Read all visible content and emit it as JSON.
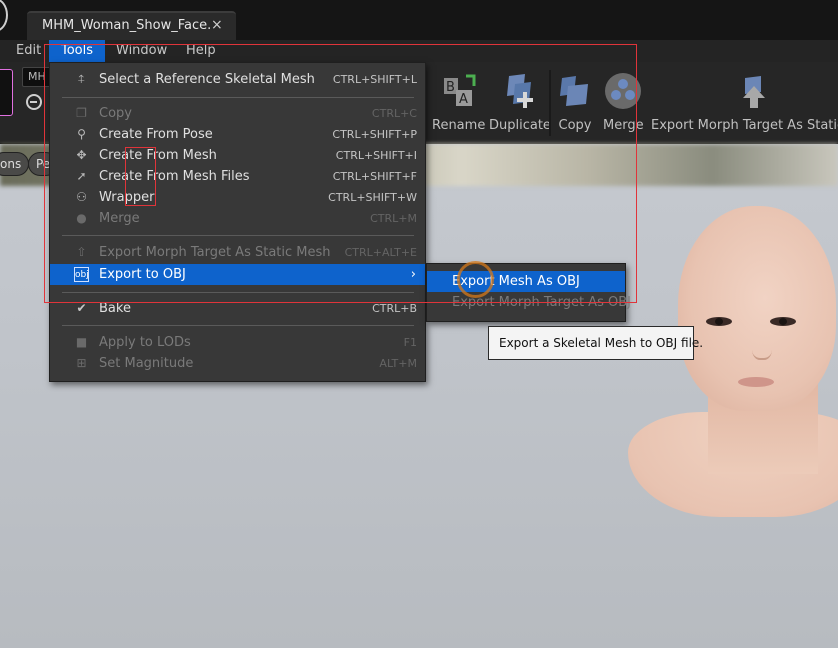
{
  "tab": {
    "title": "MHM_Woman_Show_Face...",
    "close": "×"
  },
  "menubar": {
    "items": [
      {
        "label": "Edit"
      },
      {
        "label": "Tools"
      },
      {
        "label": "Window"
      },
      {
        "label": "Help"
      }
    ]
  },
  "toolbar": {
    "asset_name": "MH",
    "buttons": [
      {
        "label": "Rename",
        "icon": "rename-icon"
      },
      {
        "label": "Duplicate",
        "icon": "duplicate-icon"
      },
      {
        "label": "Copy",
        "icon": "copy-icon"
      },
      {
        "label": "Merge",
        "icon": "merge-icon"
      },
      {
        "label": "Export Morph Target As Static M",
        "icon": "export-morph-icon"
      }
    ]
  },
  "viewport": {
    "pills": [
      {
        "label": "ons"
      },
      {
        "label": "Pe"
      }
    ]
  },
  "tools_menu": {
    "items": [
      {
        "label": "Select a Reference Skeletal Mesh",
        "shortcut": "CTRL+SHIFT+L",
        "icon": "skeleton-icon",
        "enabled": true
      },
      {
        "label": "Copy",
        "shortcut": "CTRL+C",
        "icon": "copy-icon",
        "enabled": false
      },
      {
        "label": "Create From Pose",
        "shortcut": "CTRL+SHIFT+P",
        "icon": "pose-icon",
        "enabled": true
      },
      {
        "label": "Create From Mesh",
        "shortcut": "CTRL+SHIFT+I",
        "icon": "mesh-icon",
        "enabled": true
      },
      {
        "label": "Create From Mesh Files",
        "shortcut": "CTRL+SHIFT+F",
        "icon": "mesh-files-icon",
        "enabled": true
      },
      {
        "label": "Wrapper",
        "shortcut": "CTRL+SHIFT+W",
        "icon": "wrapper-icon",
        "enabled": true
      },
      {
        "label": "Merge",
        "shortcut": "CTRL+M",
        "icon": "merge-icon",
        "enabled": false
      },
      {
        "label": "Export Morph Target As Static Mesh",
        "shortcut": "CTRL+ALT+E",
        "icon": "export-morph-icon",
        "enabled": false
      },
      {
        "label": "Export to OBJ",
        "shortcut": "",
        "icon": "obj-icon",
        "enabled": true,
        "highlighted": true,
        "submenu": true
      },
      {
        "label": "Bake",
        "shortcut": "CTRL+B",
        "icon": "bake-check-icon",
        "enabled": true
      },
      {
        "label": "Apply to LODs",
        "shortcut": "F1",
        "icon": "lods-icon",
        "enabled": false
      },
      {
        "label": "Set Magnitude",
        "shortcut": "ALT+M",
        "icon": "magnitude-icon",
        "enabled": false
      }
    ]
  },
  "export_submenu": {
    "items": [
      {
        "label": "Export Mesh As OBJ",
        "highlighted": true,
        "enabled": true
      },
      {
        "label": "Export Morph Target As OBJ",
        "enabled": false
      }
    ]
  },
  "tooltip": {
    "text": "Export a Skeletal Mesh to OBJ file."
  },
  "colors": {
    "highlight": "#0e63cc",
    "menu_bg": "#383838",
    "annotation": "#e0343a",
    "cursor": "#d4781a"
  }
}
